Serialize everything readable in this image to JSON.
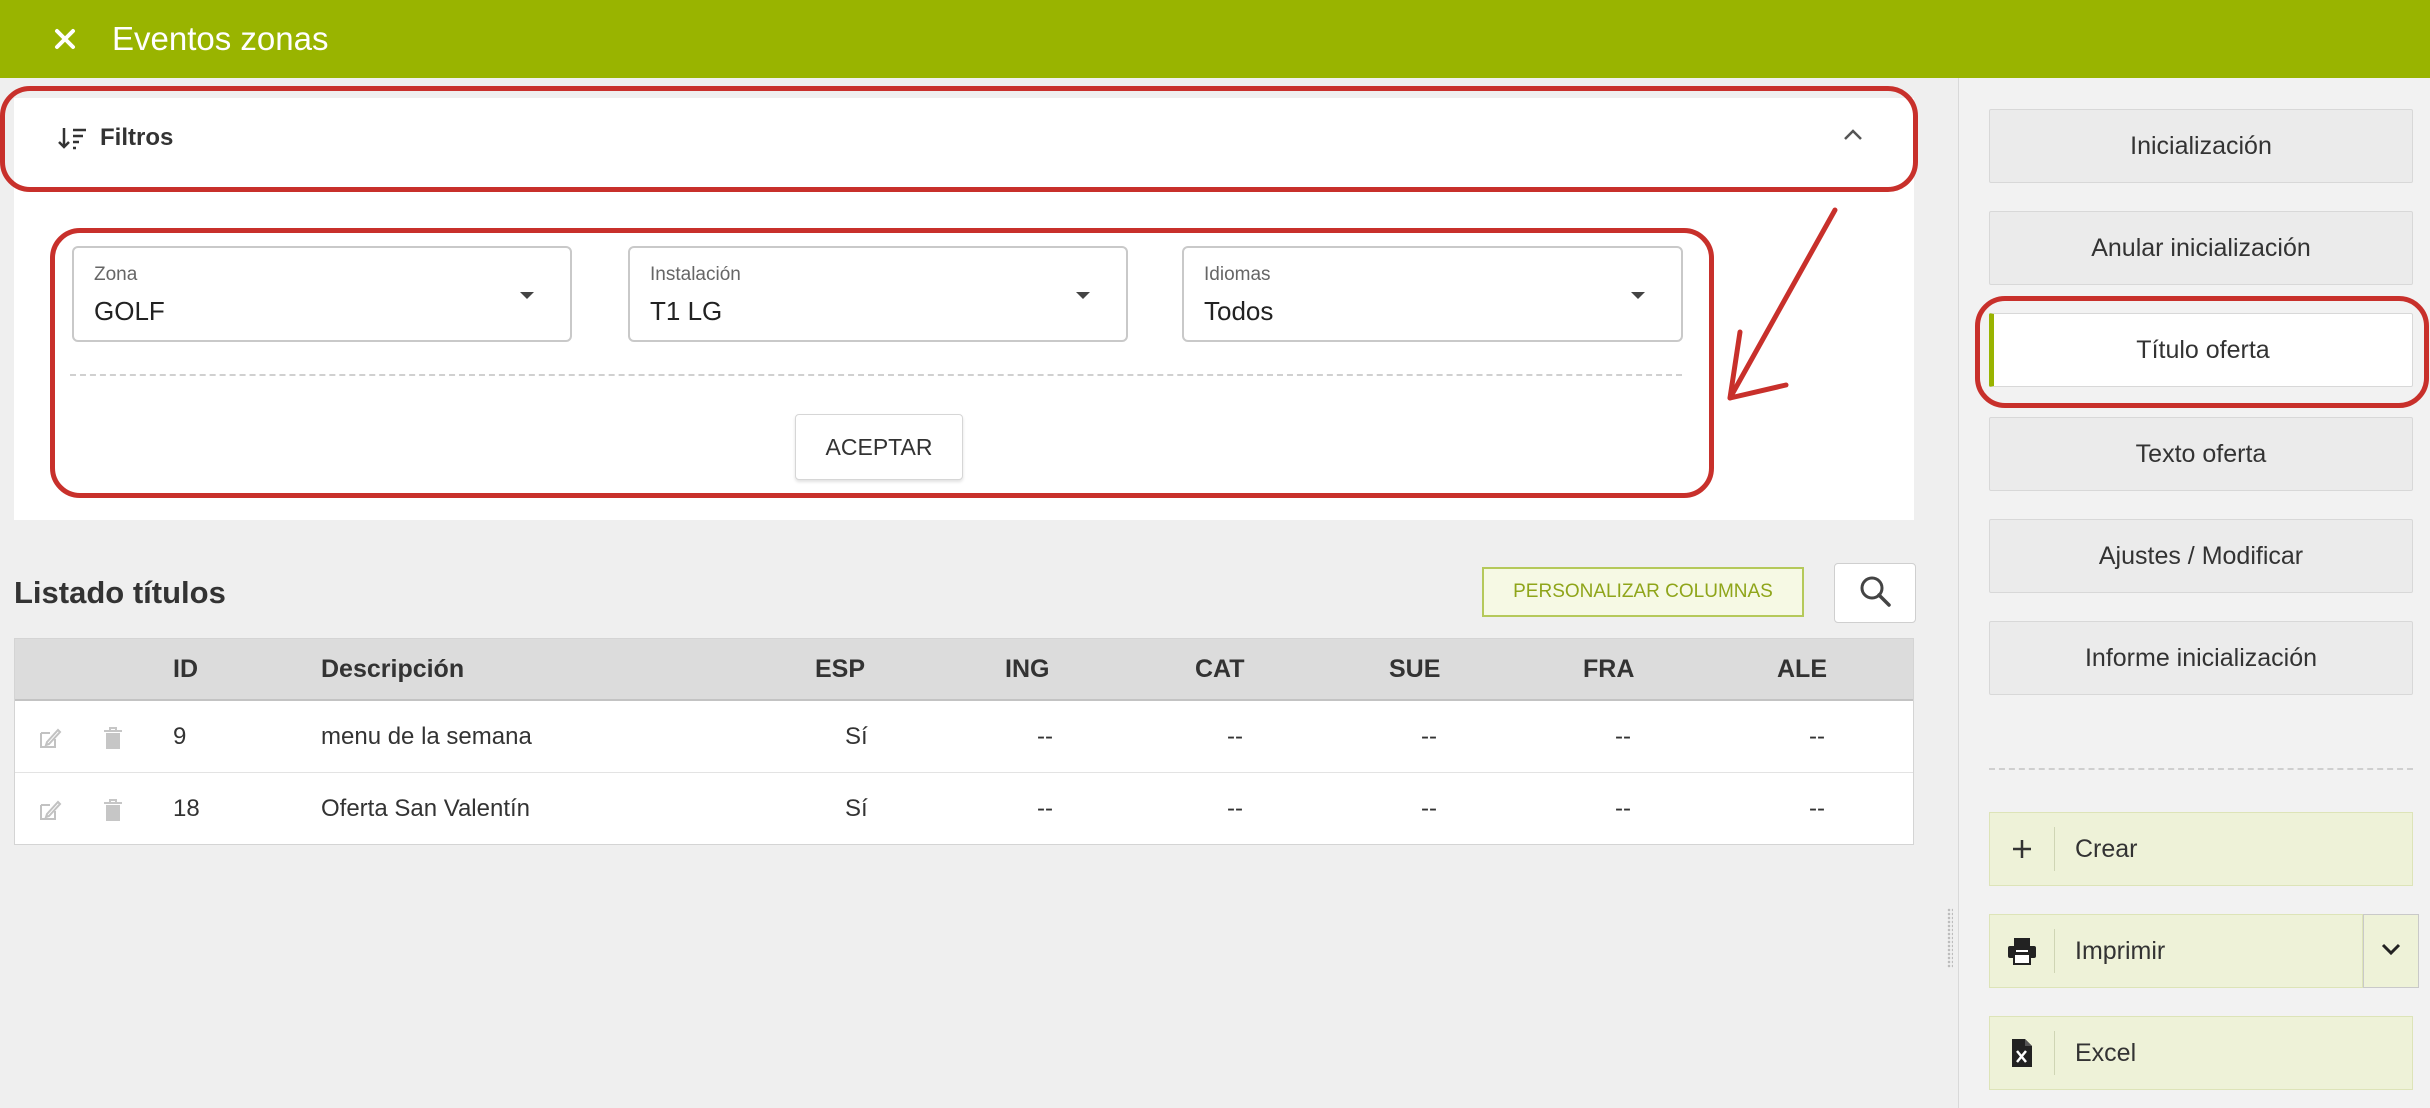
{
  "window": {
    "title": "Eventos zonas"
  },
  "filters": {
    "title": "Filtros",
    "fields": [
      {
        "label": "Zona",
        "value": "GOLF"
      },
      {
        "label": "Instalación",
        "value": "T1 LG"
      },
      {
        "label": "Idiomas",
        "value": "Todos"
      }
    ],
    "accept_label": "ACEPTAR"
  },
  "list": {
    "title": "Listado títulos",
    "customize_label": "PERSONALIZAR COLUMNAS",
    "columns": [
      "ID",
      "Descripción",
      "ESP",
      "ING",
      "CAT",
      "SUE",
      "FRA",
      "ALE"
    ],
    "rows": [
      {
        "id": "9",
        "desc": "menu de la semana",
        "esp": "Sí",
        "ing": "--",
        "cat": "--",
        "sue": "--",
        "fra": "--",
        "ale": "--"
      },
      {
        "id": "18",
        "desc": "Oferta San Valentín",
        "esp": "Sí",
        "ing": "--",
        "cat": "--",
        "sue": "--",
        "fra": "--",
        "ale": "--"
      }
    ]
  },
  "sidebar": {
    "buttons": [
      {
        "label": "Inicialización"
      },
      {
        "label": "Anular inicialización"
      },
      {
        "label": "Título oferta"
      },
      {
        "label": "Texto oferta"
      },
      {
        "label": "Ajustes / Modificar"
      },
      {
        "label": "Informe inicialización"
      }
    ],
    "actions": [
      {
        "label": "Crear",
        "icon": "plus-icon"
      },
      {
        "label": "Imprimir",
        "icon": "printer-icon"
      },
      {
        "label": "Excel",
        "icon": "excel-file-icon"
      }
    ]
  },
  "colors": {
    "brand": "#99b400",
    "annotation": "#c8302b"
  }
}
